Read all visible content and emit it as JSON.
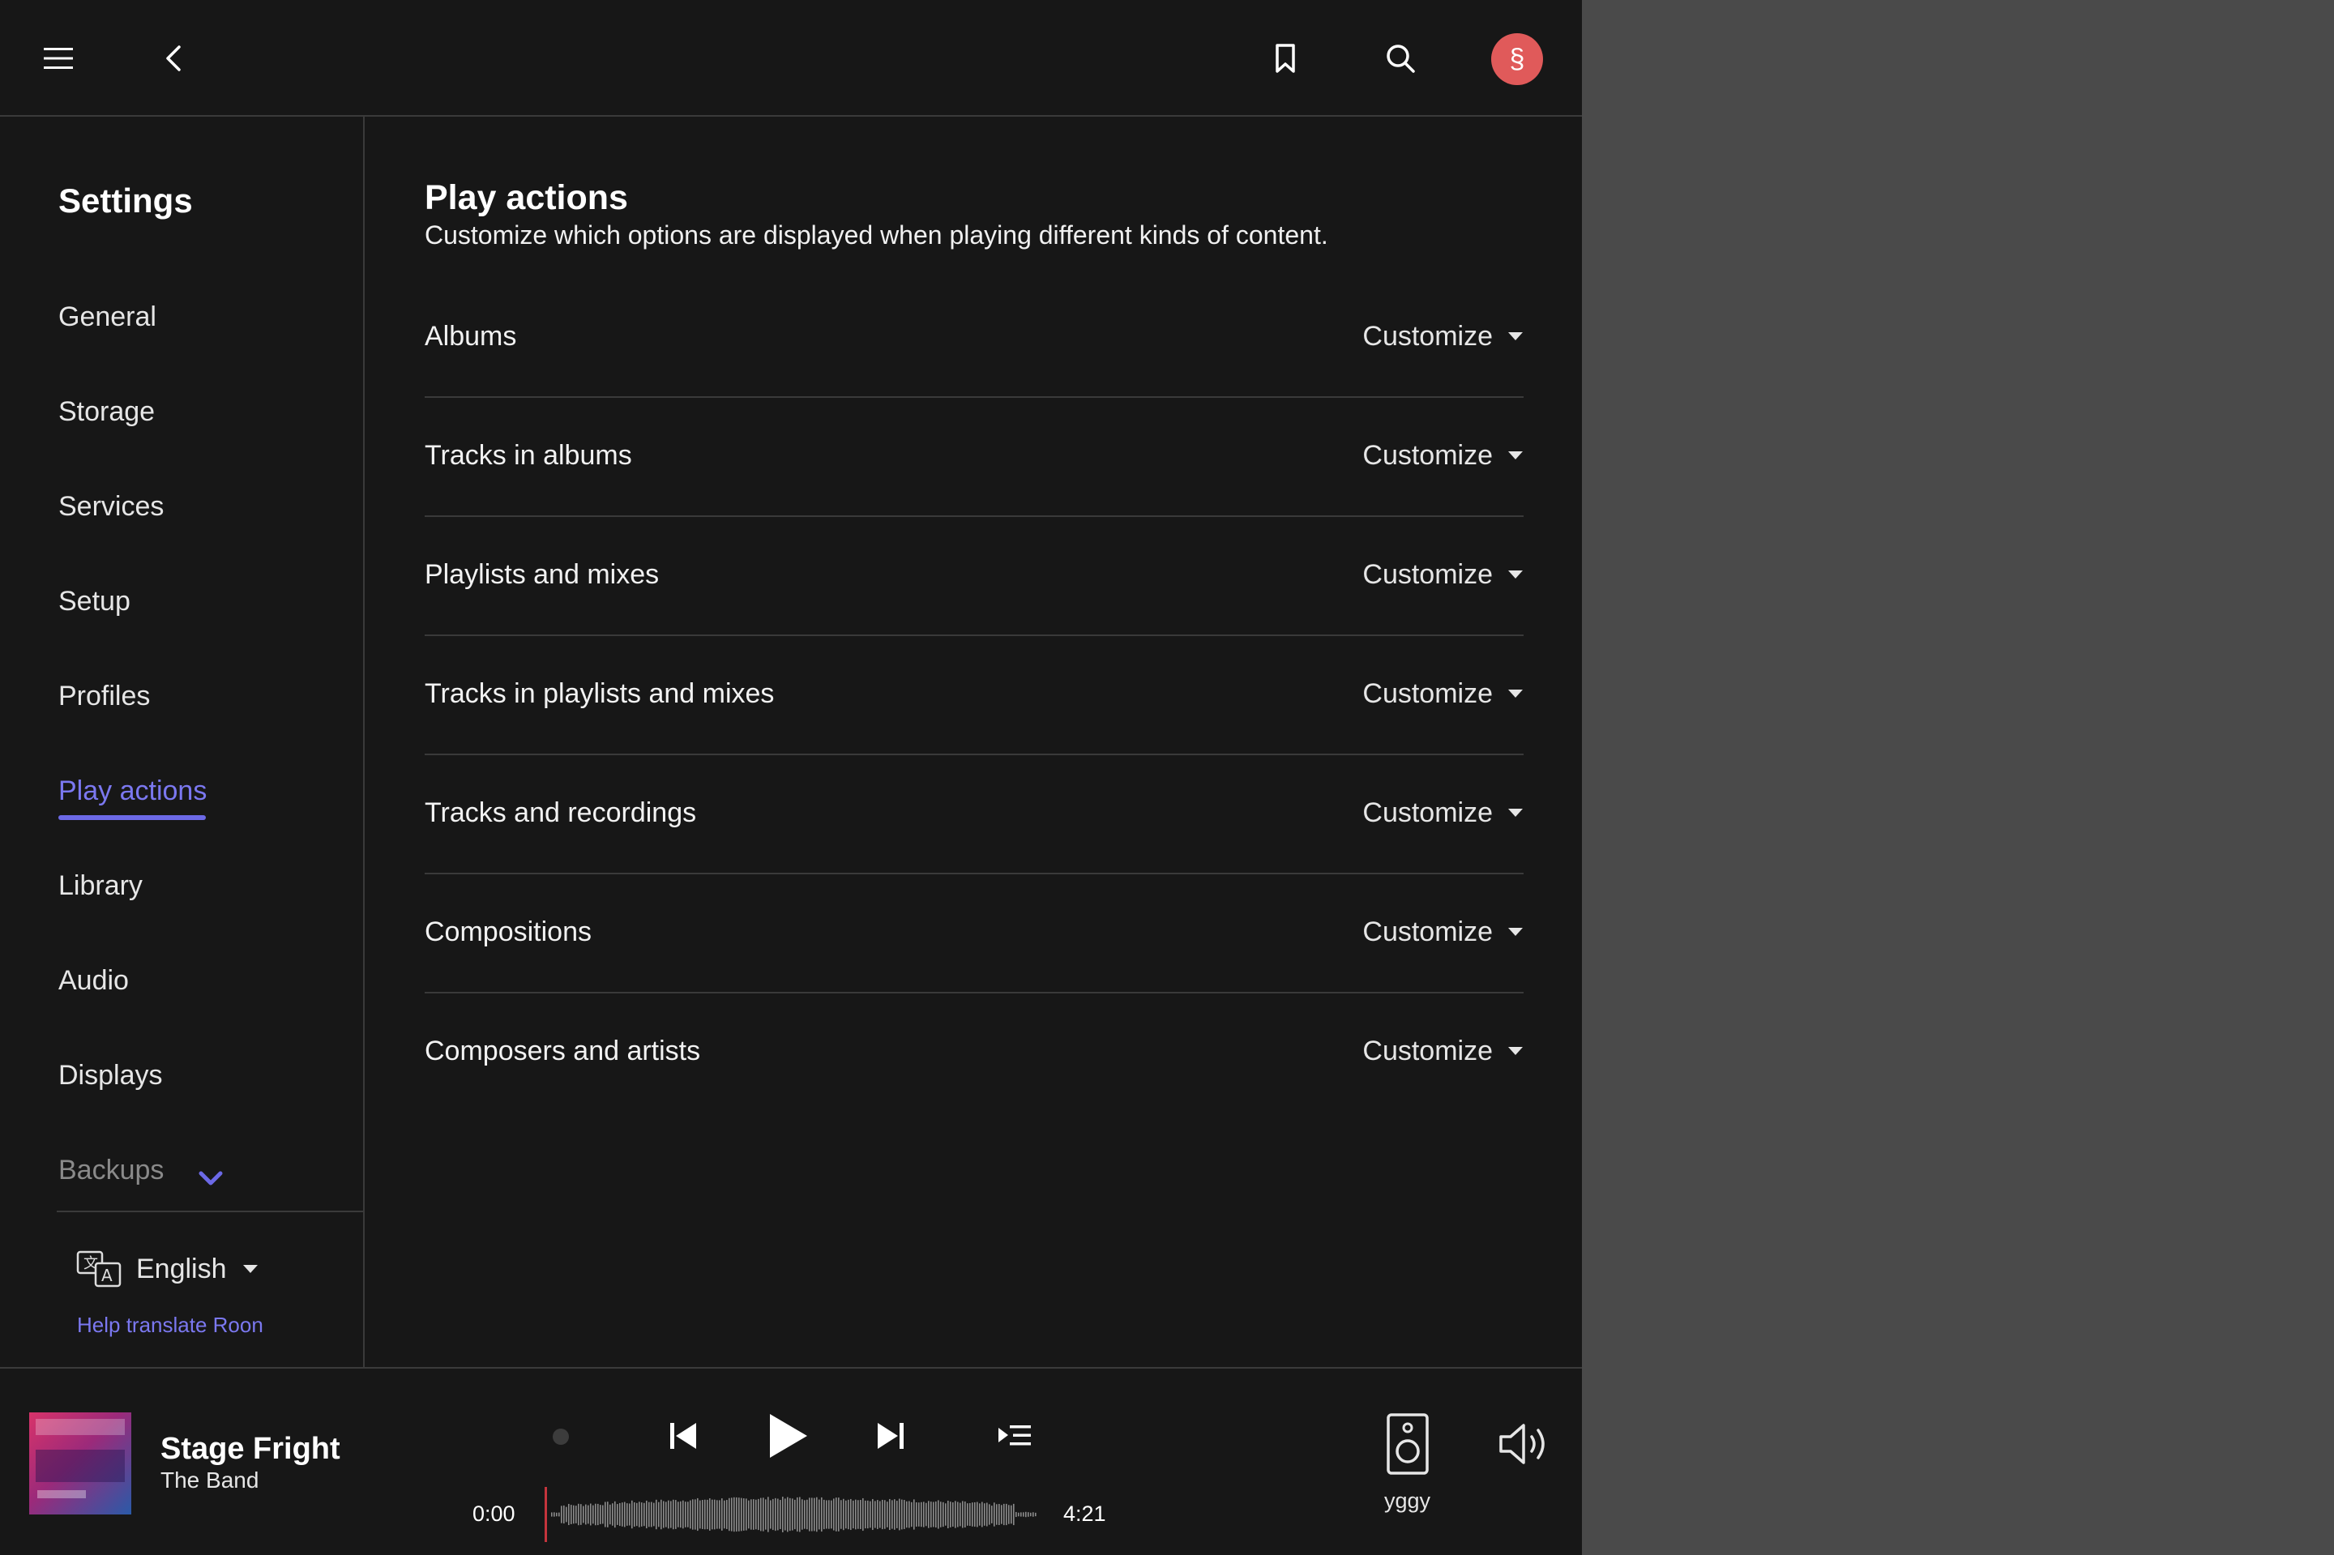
{
  "header": {
    "icons": [
      "menu-icon",
      "back-icon",
      "bookmark-icon",
      "search-icon"
    ],
    "avatar_letter": "§",
    "avatar_color": "#e05a5a"
  },
  "sidebar": {
    "title": "Settings",
    "items": [
      {
        "label": "General"
      },
      {
        "label": "Storage"
      },
      {
        "label": "Services"
      },
      {
        "label": "Setup"
      },
      {
        "label": "Profiles"
      },
      {
        "label": "Play actions"
      },
      {
        "label": "Library"
      },
      {
        "label": "Audio"
      },
      {
        "label": "Displays"
      },
      {
        "label": "Backups"
      }
    ],
    "active_item": "Play actions",
    "language": "English",
    "help_link": "Help translate Roon"
  },
  "main": {
    "title": "Play actions",
    "subtitle": "Customize which options are displayed when playing different kinds of content.",
    "rows": [
      {
        "label": "Albums",
        "action": "Customize"
      },
      {
        "label": "Tracks in albums",
        "action": "Customize"
      },
      {
        "label": "Playlists and mixes",
        "action": "Customize"
      },
      {
        "label": "Tracks in playlists and mixes",
        "action": "Customize"
      },
      {
        "label": "Tracks and recordings",
        "action": "Customize"
      },
      {
        "label": "Compositions",
        "action": "Customize"
      },
      {
        "label": "Composers and artists",
        "action": "Customize"
      }
    ]
  },
  "player": {
    "track_title": "Stage Fright",
    "track_artist": "The Band",
    "time_elapsed": "0:00",
    "time_total": "4:21",
    "progress": 0,
    "zone_name": "yggy"
  },
  "colors": {
    "accent": "#6c69e6",
    "background": "#171717",
    "outer_background": "#4a4a4a",
    "divider": "#3a3a3a"
  }
}
